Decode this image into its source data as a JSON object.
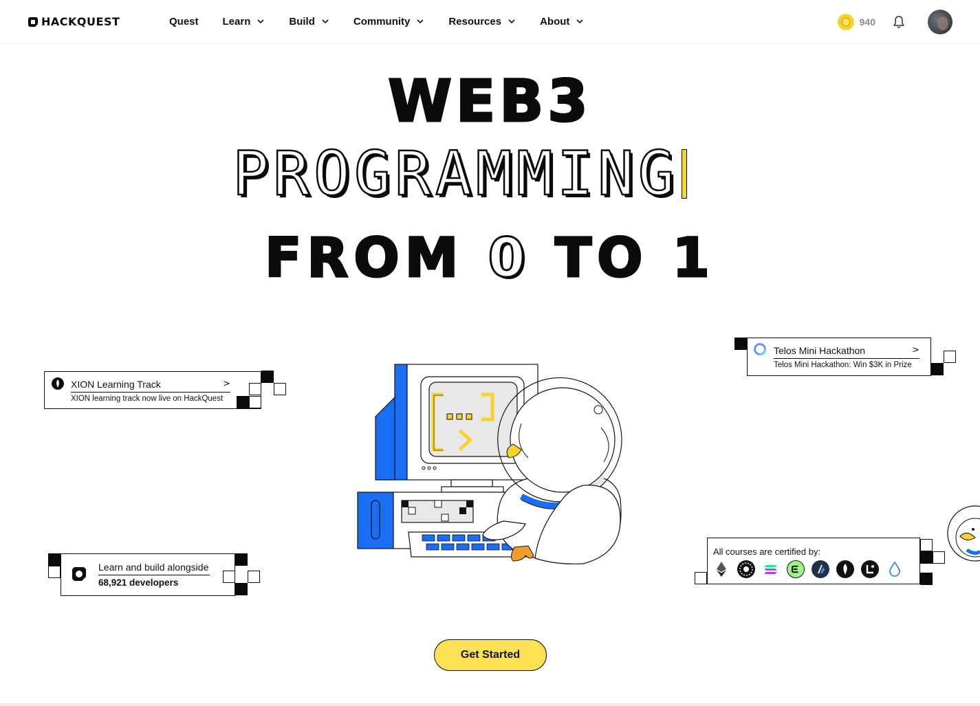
{
  "nav": {
    "brand": "HACKQUEST",
    "items": [
      {
        "label": "Quest",
        "dropdown": false
      },
      {
        "label": "Learn",
        "dropdown": true
      },
      {
        "label": "Build",
        "dropdown": true
      },
      {
        "label": "Community",
        "dropdown": true
      },
      {
        "label": "Resources",
        "dropdown": true
      },
      {
        "label": "About",
        "dropdown": true
      }
    ],
    "coins": "940"
  },
  "hero": {
    "line1": "WEB3",
    "line2": "PROGRAMMING",
    "line3_pre": "FROM ",
    "line3_zero": "0",
    "line3_post": " TO 1"
  },
  "cards": {
    "xion": {
      "title": "XION Learning Track",
      "arrow": ">",
      "subtitle": "XION learning track now live on HackQuest"
    },
    "telos": {
      "title": "Telos Mini Hackathon",
      "arrow": ">",
      "subtitle": "Telos Mini Hackathon: Win $3K in Prize"
    },
    "community": {
      "title": "Learn and build alongside",
      "count": "68,921 developers"
    },
    "certified": {
      "title": "All courses are certified by:",
      "logos": [
        "ethereum-icon",
        "arweave-icon",
        "solana-icon",
        "eclipse-icon",
        "arbitrum-icon",
        "xion-icon",
        "linea-icon",
        "drop-icon"
      ]
    }
  },
  "cta": {
    "label": "Get Started"
  },
  "colors": {
    "accent": "#fde154",
    "blue": "#1a6ef5",
    "ink": "#0b0b0b"
  }
}
